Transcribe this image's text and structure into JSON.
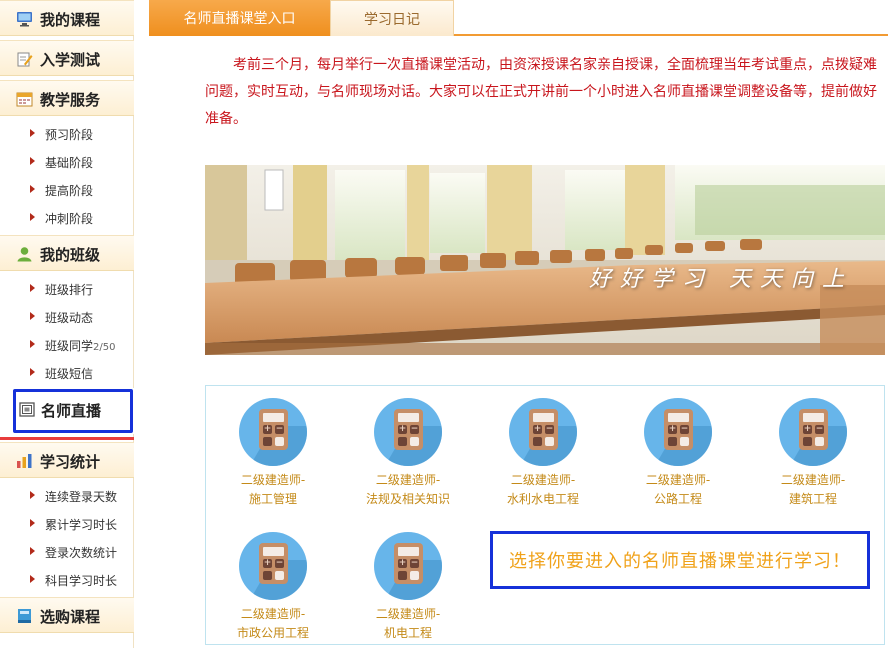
{
  "sidebar": {
    "sections": [
      {
        "label": "我的课程",
        "icon": "monitor-icon"
      },
      {
        "label": "入学测试",
        "icon": "pencil-paper-icon"
      },
      {
        "label": "教学服务",
        "icon": "calendar-icon"
      },
      {
        "label": "我的班级",
        "icon": "user-icon"
      },
      {
        "label": "学习统计",
        "icon": "bar-chart-icon"
      },
      {
        "label": "选购课程",
        "icon": "book-icon"
      }
    ],
    "teaching_items": [
      "预习阶段",
      "基础阶段",
      "提高阶段",
      "冲刺阶段"
    ],
    "class_items": [
      "班级排行",
      "班级动态",
      "班级同学",
      "班级短信"
    ],
    "class_mates_count": "2/50",
    "live_item": {
      "label": "名师直播",
      "icon": "live-icon"
    },
    "stats_items": [
      "连续登录天数",
      "累计学习时长",
      "登录次数统计",
      "科目学习时长"
    ]
  },
  "tabs": {
    "live": "名师直播课堂入口",
    "diary": "学习日记"
  },
  "intro": "考前三个月，每月举行一次直播课堂活动，由资深授课名家亲自授课，全面梳理当年考试重点，点拨疑难问题，实时互动，与名师现场对话。大家可以在正式开讲前一个小时进入名师直播课堂调整设备等，提前做好准备。",
  "banner": {
    "slogan": "好好学习  天天向上"
  },
  "courses": [
    {
      "line1": "二级建造师-",
      "line2": "施工管理"
    },
    {
      "line1": "二级建造师-",
      "line2": "法规及相关知识"
    },
    {
      "line1": "二级建造师-",
      "line2": "水利水电工程"
    },
    {
      "line1": "二级建造师-",
      "line2": "公路工程"
    },
    {
      "line1": "二级建造师-",
      "line2": "建筑工程"
    },
    {
      "line1": "二级建造师-",
      "line2": "市政公用工程"
    },
    {
      "line1": "二级建造师-",
      "line2": "机电工程"
    }
  ],
  "hint": "选择你要进入的名师直播课堂进行学习！",
  "colors": {
    "accent": "#f29b33",
    "intro_text": "#c8161d",
    "course_text": "#c48a18",
    "highlight": "#1531d9",
    "hint_text": "#f0a21a"
  }
}
